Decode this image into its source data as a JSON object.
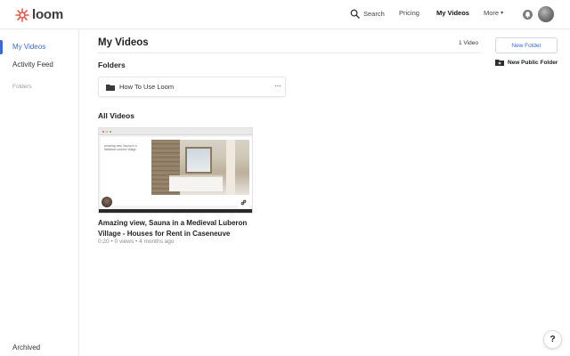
{
  "brand": {
    "name": "loom",
    "logo_icon": "loom-logo-icon",
    "color": "#e85c49"
  },
  "topnav": {
    "search_label": "Search",
    "pricing_label": "Pricing",
    "my_videos_label": "My Videos",
    "more_label": "More",
    "caret": "▾"
  },
  "sidebar": {
    "items": [
      {
        "label": "My Videos",
        "active": true
      },
      {
        "label": "Activity Feed",
        "active": false
      }
    ],
    "section_label": "Folders",
    "archived_label": "Archived"
  },
  "main": {
    "title": "My Videos",
    "video_count": "1 Video",
    "folders_heading": "Folders",
    "folders": [
      {
        "name": "How To Use Loom",
        "menu": "···"
      }
    ],
    "all_videos_heading": "All Videos",
    "videos": [
      {
        "title": "Amazing view, Sauna in a Medieval Luberon Village - Houses for Rent in Caseneuve",
        "meta": "0:20 • 0 views • 4 months ago",
        "thumb_caption": "Amazing view, Sauna in a Medieval Luberon Village"
      }
    ]
  },
  "actions": {
    "new_folder_label": "New Folder",
    "new_public_folder_label": "New Public Folder"
  },
  "help": {
    "label": "?"
  },
  "colors": {
    "accent": "#3c67d8",
    "brand": "#e85c49"
  }
}
